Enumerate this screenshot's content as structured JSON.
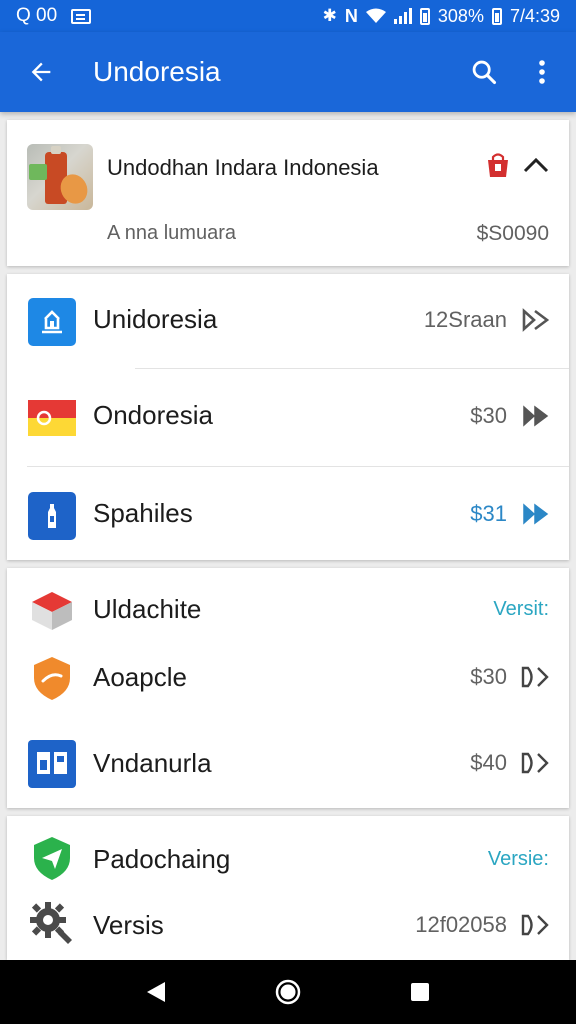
{
  "status": {
    "left_time": "Q 00",
    "battery": "308%",
    "clock": "7/4:39"
  },
  "app_bar": {
    "title": "Undoresia"
  },
  "product": {
    "name": "Undodhan Indara Indonesia",
    "subtitle": "A nna lumuara",
    "price": "$S0090"
  },
  "list1": [
    {
      "name": "Unidoresia",
      "value": "12Sraan",
      "arrow": "double"
    },
    {
      "name": "Ondoresia",
      "value": "$30",
      "arrow": "double"
    },
    {
      "name": "Spahiles",
      "value": "$31",
      "arrow": "double",
      "value_color": "#2b87c6"
    }
  ],
  "list2": [
    {
      "name": "Uldachite",
      "value": "Versit:"
    },
    {
      "name": "Aoapcle",
      "value": "$30",
      "arrow": "D>"
    },
    {
      "name": "Vndanurla",
      "value": "$40",
      "arrow": "D>"
    }
  ],
  "list3": [
    {
      "name": "Padochaing",
      "value": "Versie:"
    },
    {
      "name": "Versis",
      "value": "12f02058",
      "arrow": "D>"
    }
  ],
  "icons": {
    "back": "arrow-back-icon",
    "search": "search-icon",
    "more": "more-vert-icon",
    "bag": "shopping-bag-icon",
    "collapse": "chevron-up-icon",
    "nav_back": "triangle-back-icon",
    "nav_home": "circle-home-icon",
    "nav_recents": "square-recents-icon"
  },
  "colors": {
    "primary": "#1a67d9",
    "accent_value": "#2b87c6",
    "link_value": "#2ba6c2",
    "bag_red": "#d32f2f"
  }
}
